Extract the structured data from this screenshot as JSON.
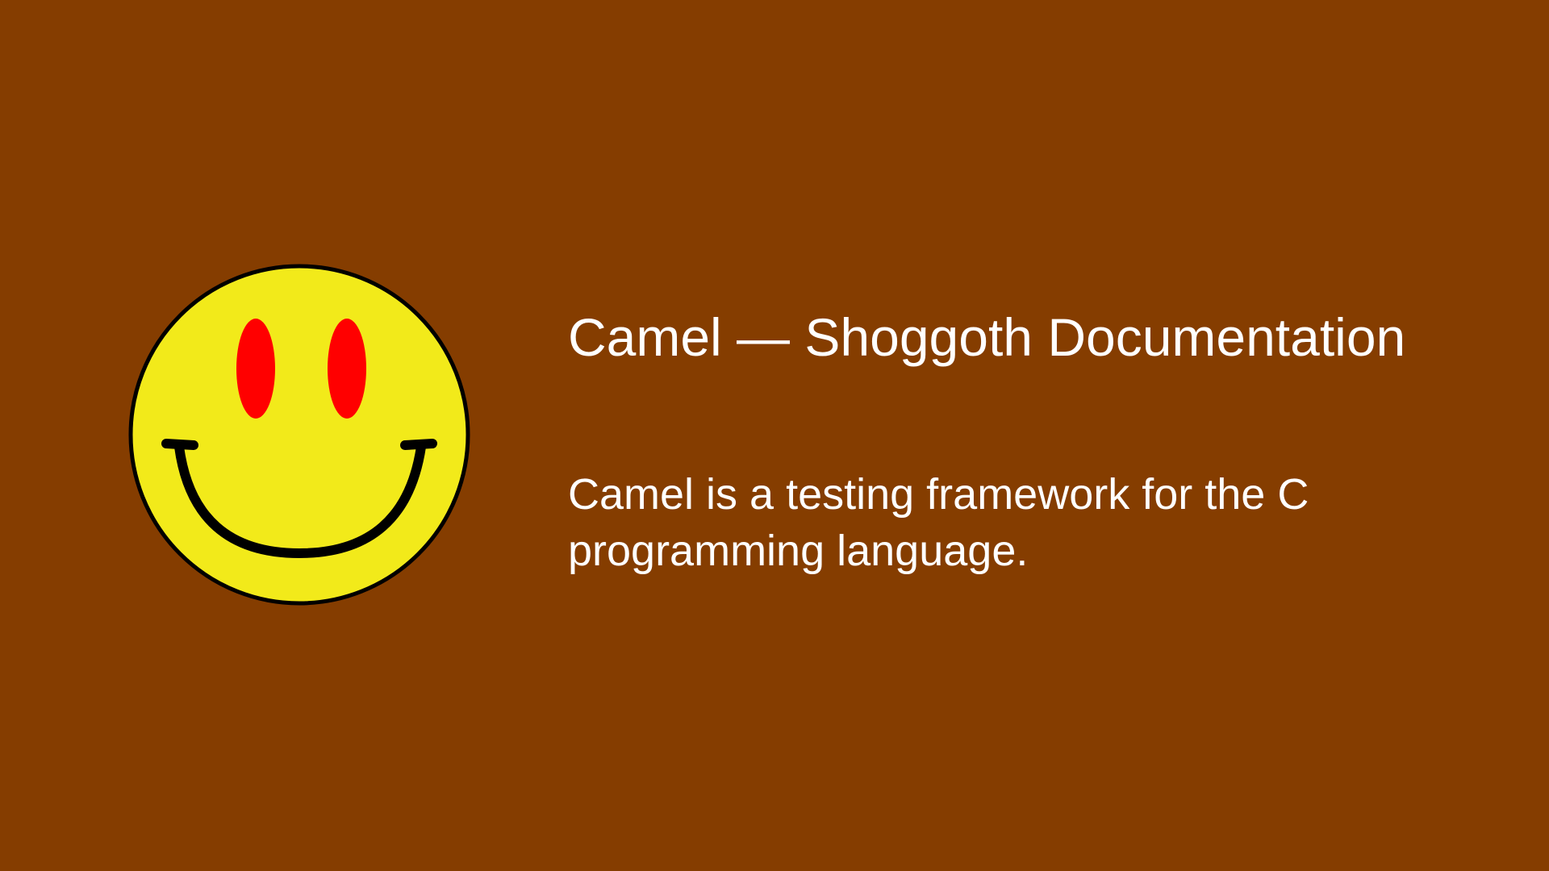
{
  "page": {
    "title": "Camel — Shoggoth Documentation",
    "description": "Camel is a testing framework for the C programming language."
  },
  "logo": {
    "icon": "smiley-face-icon"
  },
  "colors": {
    "background": "#853d00",
    "text": "#ffffff",
    "logo_face": "#f2ea1a",
    "logo_eyes": "#ff0000",
    "logo_outline": "#000000"
  }
}
